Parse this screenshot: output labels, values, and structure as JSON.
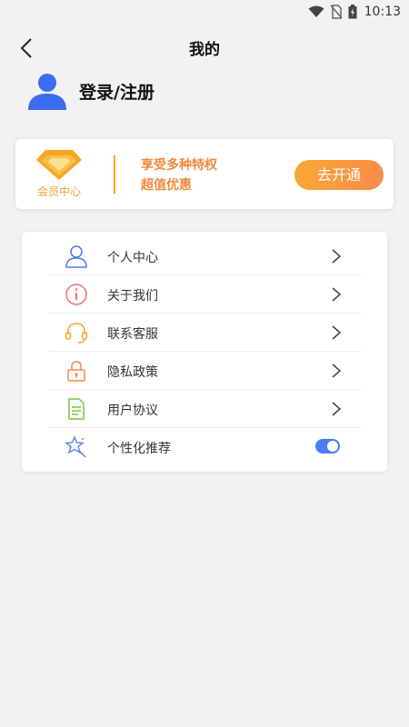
{
  "status_bar": {
    "time": "10:13"
  },
  "header": {
    "title": "我的"
  },
  "user": {
    "login_label": "登录/注册"
  },
  "vip": {
    "badge_label": "会员中心",
    "line1": "享受多种特权",
    "line2": "超值优惠",
    "button_label": "去开通"
  },
  "menu": {
    "items": [
      {
        "label": "个人中心",
        "icon": "person-icon"
      },
      {
        "label": "关于我们",
        "icon": "info-icon"
      },
      {
        "label": "联系客服",
        "icon": "headset-icon"
      },
      {
        "label": "隐私政策",
        "icon": "lock-icon"
      },
      {
        "label": "用户协议",
        "icon": "document-icon"
      },
      {
        "label": "个性化推荐",
        "icon": "star-magic-icon",
        "toggle_on": true
      }
    ]
  },
  "colors": {
    "accent_blue": "#4a7bf0",
    "vip_orange": "#f5a623",
    "background": "#f2f2f2"
  }
}
